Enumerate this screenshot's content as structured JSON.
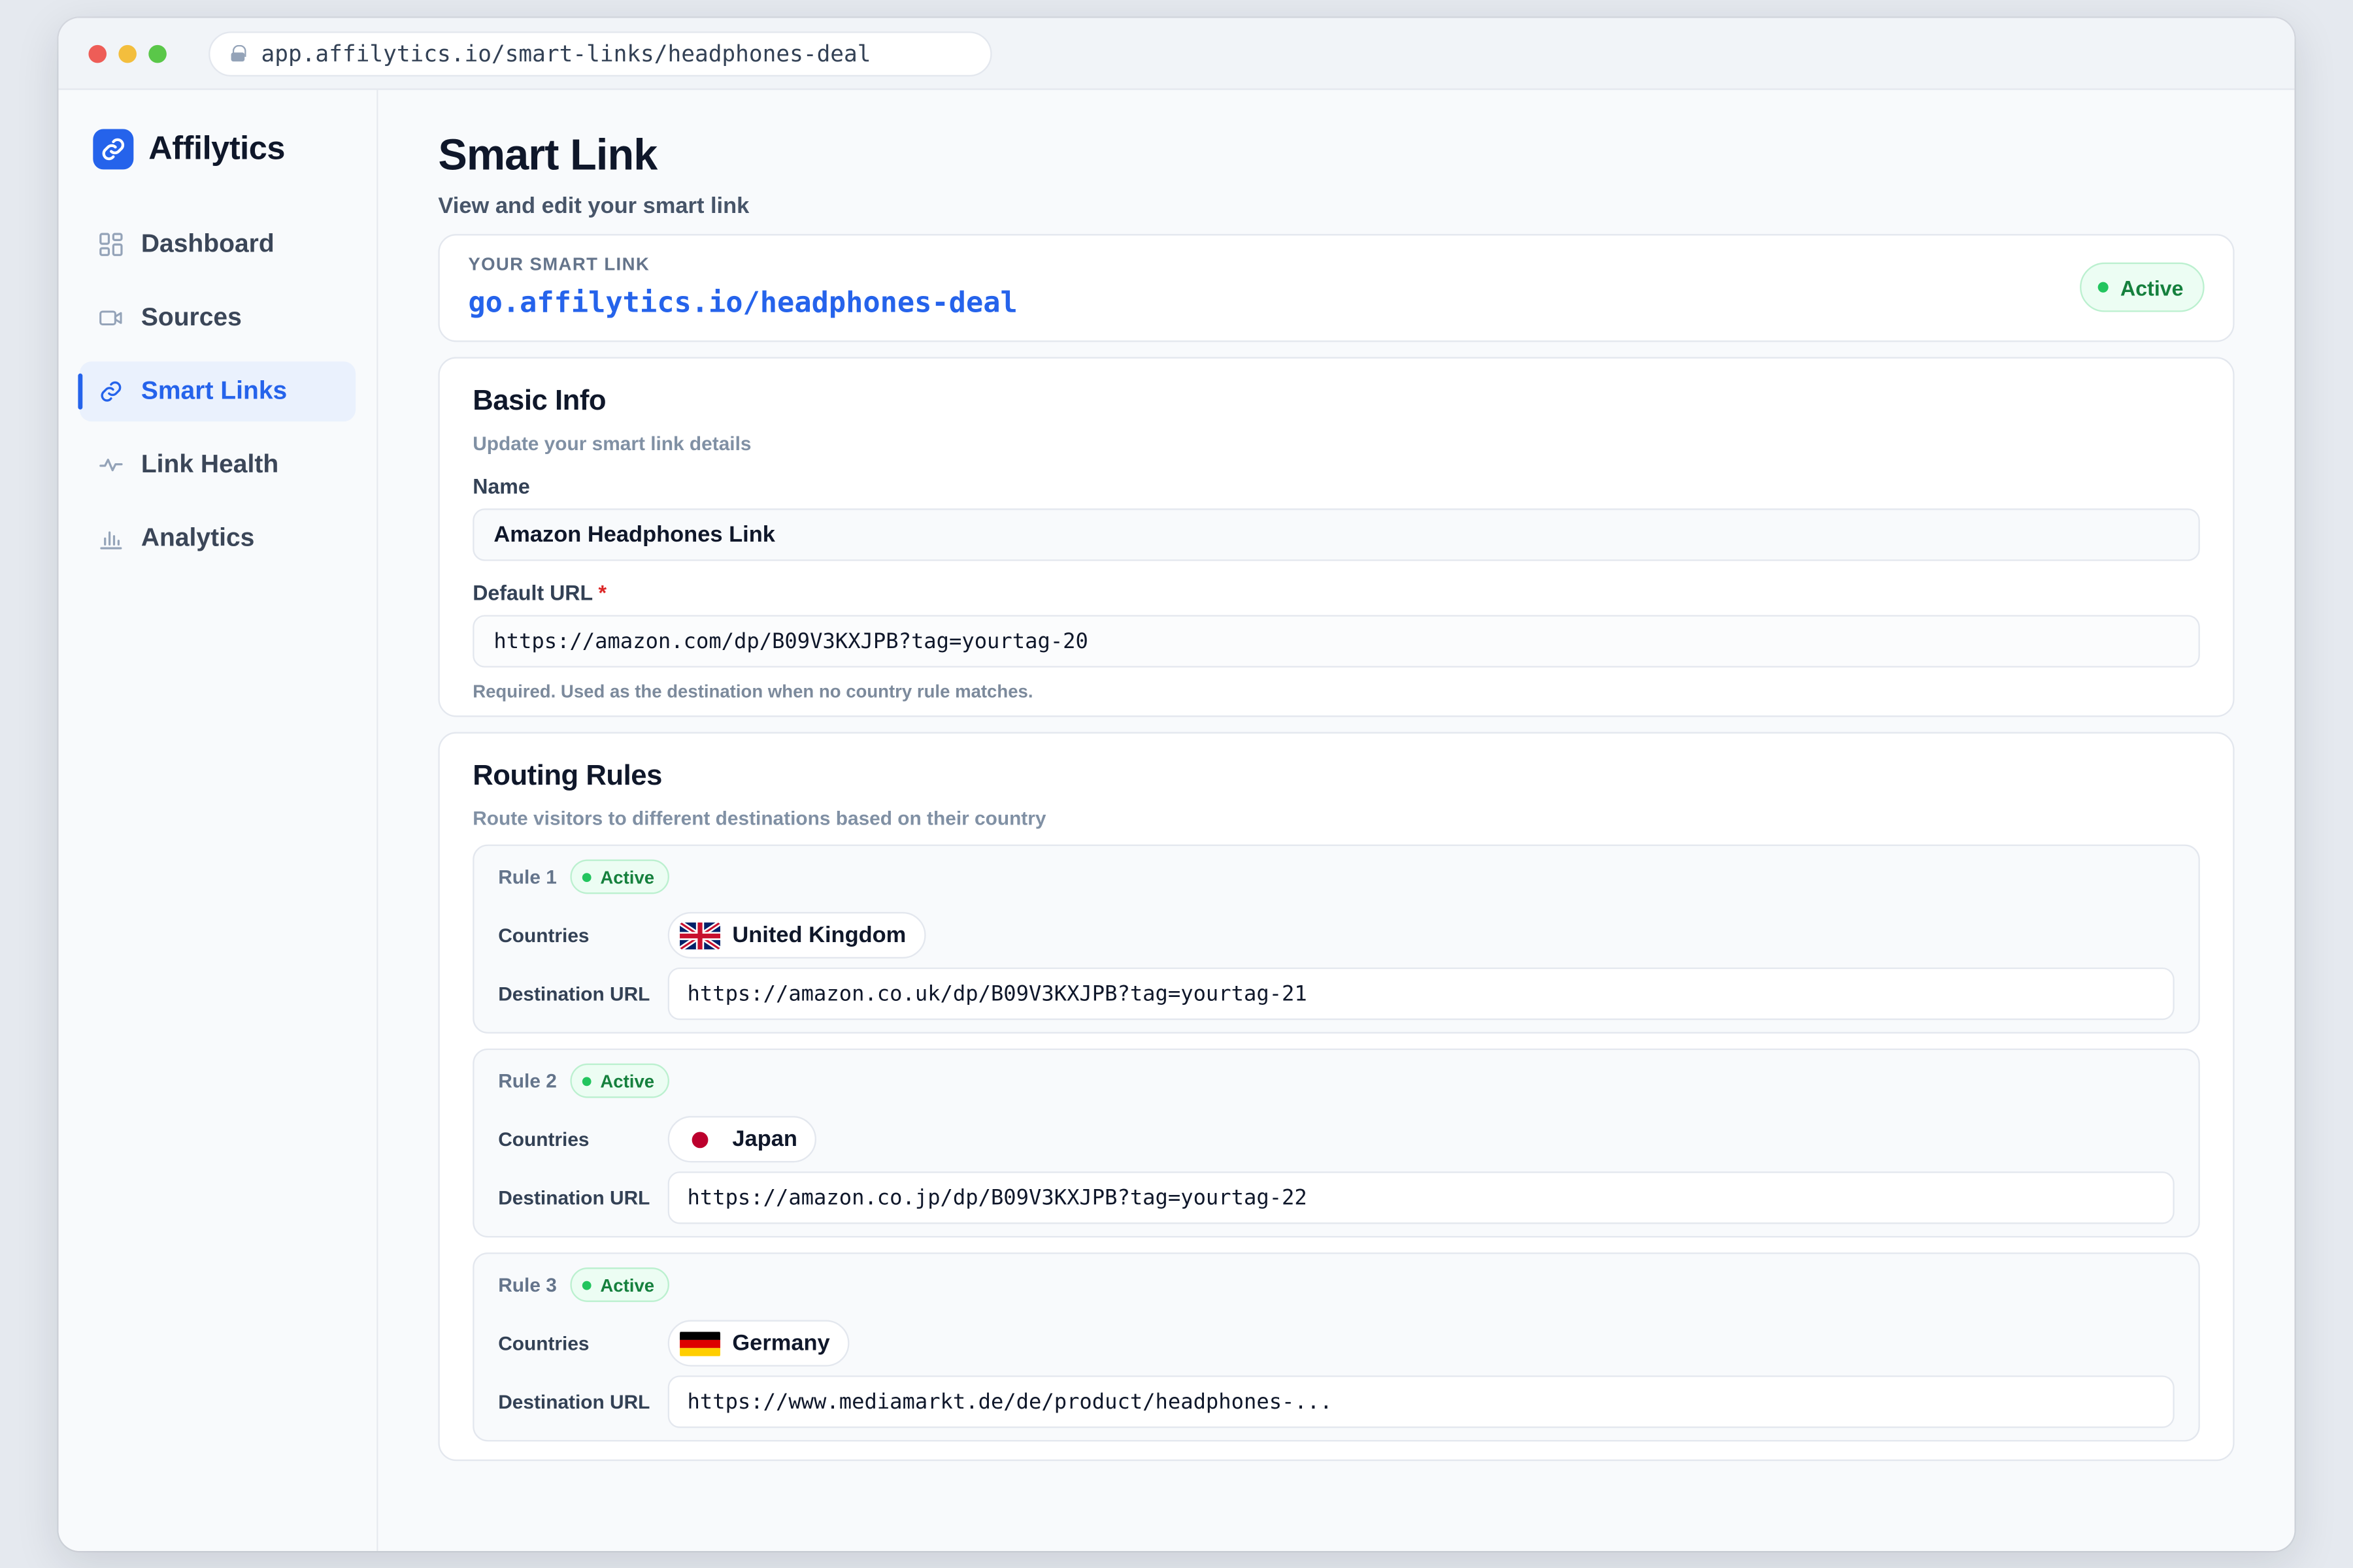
{
  "browser": {
    "url": "app.affilytics.io/smart-links/headphones-deal"
  },
  "brand": {
    "name": "Affilytics"
  },
  "sidebar": {
    "items": [
      {
        "label": "Dashboard",
        "icon": "grid-icon"
      },
      {
        "label": "Sources",
        "icon": "video-icon"
      },
      {
        "label": "Smart Links",
        "icon": "link-icon",
        "active": true
      },
      {
        "label": "Link Health",
        "icon": "pulse-icon"
      },
      {
        "label": "Analytics",
        "icon": "bar-chart-icon"
      }
    ]
  },
  "page": {
    "title": "Smart Link",
    "subtitle": "View and edit your smart link"
  },
  "smart_link": {
    "caption": "YOUR SMART LINK",
    "url": "go.affilytics.io/headphones-deal",
    "status": "Active"
  },
  "basic_info": {
    "title": "Basic Info",
    "subtitle": "Update your smart link details",
    "name_label": "Name",
    "name_value": "Amazon Headphones Link",
    "default_url_label": "Default URL",
    "required_mark": "*",
    "default_url_value": "https://amazon.com/dp/B09V3KXJPB?tag=yourtag-20",
    "hint": "Required. Used as the destination when no country rule matches."
  },
  "routing": {
    "title": "Routing Rules",
    "subtitle": "Route visitors to different destinations based on their country",
    "countries_label": "Countries",
    "destination_label": "Destination URL",
    "rules": [
      {
        "title": "Rule 1",
        "status": "Active",
        "country": "United Kingdom",
        "flag": "gb-flag-icon",
        "url": "https://amazon.co.uk/dp/B09V3KXJPB?tag=yourtag-21"
      },
      {
        "title": "Rule 2",
        "status": "Active",
        "country": "Japan",
        "flag": "jp-flag-icon",
        "url": "https://amazon.co.jp/dp/B09V3KXJPB?tag=yourtag-22"
      },
      {
        "title": "Rule 3",
        "status": "Active",
        "country": "Germany",
        "flag": "de-flag-icon",
        "url": "https://www.mediamarkt.de/de/product/headphones-..."
      }
    ]
  },
  "colors": {
    "accent": "#2563eb",
    "active_green": "#15803d",
    "required_red": "#dc2626"
  }
}
